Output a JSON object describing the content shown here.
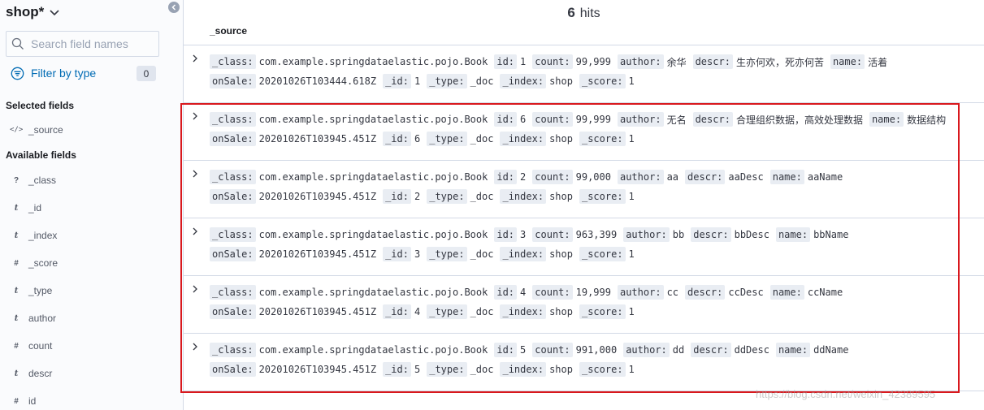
{
  "sidebar": {
    "index_pattern": "shop*",
    "search_placeholder": "Search field names",
    "filter_by_type_label": "Filter by type",
    "filter_count": "0",
    "selected_fields_title": "Selected fields",
    "selected_fields": [
      {
        "type_glyph": "</>",
        "name": "_source"
      }
    ],
    "available_fields_title": "Available fields",
    "available_fields": [
      {
        "type_glyph": "?",
        "name": "_class"
      },
      {
        "type_glyph": "t",
        "name": "_id"
      },
      {
        "type_glyph": "t",
        "name": "_index"
      },
      {
        "type_glyph": "#",
        "name": "_score"
      },
      {
        "type_glyph": "t",
        "name": "_type"
      },
      {
        "type_glyph": "t",
        "name": "author"
      },
      {
        "type_glyph": "#",
        "name": "count"
      },
      {
        "type_glyph": "t",
        "name": "descr"
      },
      {
        "type_glyph": "#",
        "name": "id"
      }
    ]
  },
  "main": {
    "hits_count": "6",
    "hits_label": "hits",
    "source_column": "_source",
    "documents": [
      {
        "_class": "com.example.springdataelastic.pojo.Book",
        "id": "1",
        "count": "99,999",
        "author": "余华",
        "descr": "生亦何欢，死亦何苦",
        "name": "活着",
        "onSale": "20201026T103444.618Z",
        "_id": "1",
        "_type": "_doc",
        "_index": "shop",
        "_score": "1"
      },
      {
        "_class": "com.example.springdataelastic.pojo.Book",
        "id": "6",
        "count": "99,999",
        "author": "无名",
        "descr": "合理组织数据，高效处理数据",
        "name": "数据结构",
        "onSale": "20201026T103945.451Z",
        "_id": "6",
        "_type": "_doc",
        "_index": "shop",
        "_score": "1"
      },
      {
        "_class": "com.example.springdataelastic.pojo.Book",
        "id": "2",
        "count": "99,000",
        "author": "aa",
        "descr": "aaDesc",
        "name": "aaName",
        "onSale": "20201026T103945.451Z",
        "_id": "2",
        "_type": "_doc",
        "_index": "shop",
        "_score": "1"
      },
      {
        "_class": "com.example.springdataelastic.pojo.Book",
        "id": "3",
        "count": "963,399",
        "author": "bb",
        "descr": "bbDesc",
        "name": "bbName",
        "onSale": "20201026T103945.451Z",
        "_id": "3",
        "_type": "_doc",
        "_index": "shop",
        "_score": "1"
      },
      {
        "_class": "com.example.springdataelastic.pojo.Book",
        "id": "4",
        "count": "19,999",
        "author": "cc",
        "descr": "ccDesc",
        "name": "ccName",
        "onSale": "20201026T103945.451Z",
        "_id": "4",
        "_type": "_doc",
        "_index": "shop",
        "_score": "1"
      },
      {
        "_class": "com.example.springdataelastic.pojo.Book",
        "id": "5",
        "count": "991,000",
        "author": "dd",
        "descr": "ddDesc",
        "name": "ddName",
        "onSale": "20201026T103945.451Z",
        "_id": "5",
        "_type": "_doc",
        "_index": "shop",
        "_score": "1"
      }
    ]
  },
  "watermark": "https://blog.csdn.net/weixin_42389595",
  "colors": {
    "accent": "#006bb4",
    "highlight_border": "#d9181d",
    "field_key_bg": "#e9edf3"
  },
  "icons": {
    "collapse": "arrow-left-circle-icon",
    "search": "search-icon",
    "filter": "filter-icon",
    "expand": "chevron-right-icon",
    "dropdown": "chevron-down-icon"
  }
}
